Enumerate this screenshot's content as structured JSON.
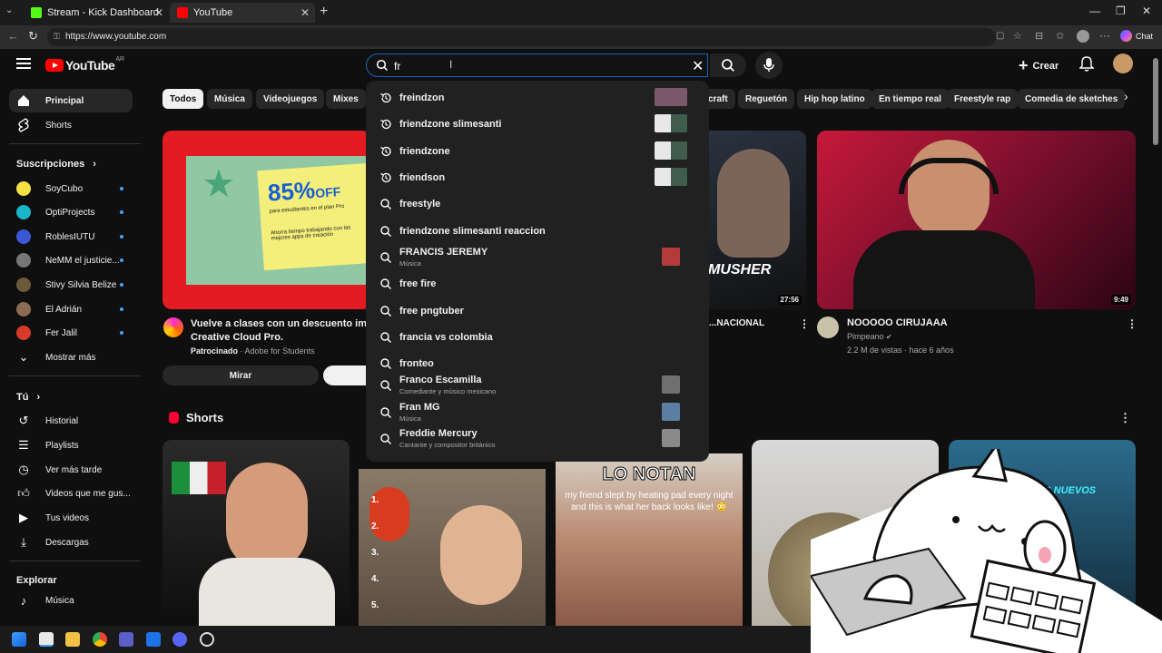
{
  "browser": {
    "tabs": [
      {
        "title": "Stream - Kick Dashboard",
        "favicon_color": "#53fc18"
      },
      {
        "title": "YouTube",
        "favicon_color": "#ff0000"
      }
    ],
    "url": "https://www.youtube.com",
    "chat_label": "Chat"
  },
  "header": {
    "logo_text": "YouTube",
    "country": "AR",
    "search_value": "fr",
    "create_label": "Crear"
  },
  "sidebar": {
    "main": [
      {
        "label": "Principal",
        "icon": "home-icon"
      },
      {
        "label": "Shorts",
        "icon": "shorts-icon"
      }
    ],
    "subscriptions_title": "Suscripciones",
    "subscriptions": [
      {
        "label": "SoyCubo",
        "color": "#f5e142"
      },
      {
        "label": "OptiProjects",
        "color": "#19b5c9"
      },
      {
        "label": "RoblesIUTU",
        "color": "#3b57d6"
      },
      {
        "label": "NeMM el justicie...",
        "color": "#777777"
      },
      {
        "label": "Stivy Silvia Belize",
        "color": "#6b5a3a"
      },
      {
        "label": "El Adrián",
        "color": "#8c6b55"
      },
      {
        "label": "Fer Jalil",
        "color": "#d63a2a"
      }
    ],
    "show_more": "Mostrar más",
    "you_title": "Tú",
    "you": [
      {
        "label": "Historial",
        "icon": "history-icon"
      },
      {
        "label": "Playlists",
        "icon": "playlists-icon"
      },
      {
        "label": "Ver más tarde",
        "icon": "watch-later-icon"
      },
      {
        "label": "Videos que me gus...",
        "icon": "like-icon"
      },
      {
        "label": "Tus videos",
        "icon": "your-videos-icon"
      },
      {
        "label": "Descargas",
        "icon": "download-icon"
      }
    ],
    "explore_title": "Explorar",
    "explore": [
      {
        "label": "Música",
        "icon": "music-icon"
      }
    ]
  },
  "chips": [
    "Todos",
    "Música",
    "Videojuegos",
    "Mixes",
    "craft",
    "Reguetón",
    "Hip hop latino",
    "En tiempo real",
    "Freestyle rap",
    "Comedia de sketches"
  ],
  "ad": {
    "title_line1": "Vuelve a clases con un descuento imper",
    "title_line2": "Creative Cloud Pro.",
    "sponsored": "Patrocinado",
    "advertiser": "Adobe for Students",
    "cta": "Mirar",
    "discount": "85%",
    "discount_suffix": "OFF",
    "sub_text": "para estudiantes en el plan Pro",
    "body_text": "Ahorra tiempo trabajando con las mejores apps de creación"
  },
  "videos": [
    {
      "title": "...NACIONAL",
      "duration": "27:56",
      "thumb_text": "MUSHER"
    },
    {
      "title": "NOOOOO CIRUJAAA",
      "channel": "Pimpeano",
      "meta": "2.2 M de vistas · hace 6 años",
      "duration": "9:49"
    }
  ],
  "shorts": {
    "title": "Shorts",
    "items": [
      {
        "overlay": ""
      },
      {
        "overlay": ""
      },
      {
        "overlay": "LO NOTAN",
        "caption": "my friend slept by heating pad every night and this is what her back looks like! 😳"
      },
      {
        "overlay": ""
      },
      {
        "overlay": "LOS NUEVOS"
      }
    ]
  },
  "suggestions": [
    {
      "text": "freindzon",
      "type": "history",
      "preview": true
    },
    {
      "text": "friendzone slimesanti",
      "type": "history",
      "preview": true
    },
    {
      "text": "friendzone",
      "type": "history",
      "preview": true
    },
    {
      "text": "friendson",
      "type": "history",
      "preview": true
    },
    {
      "text": "freestyle",
      "type": "search"
    },
    {
      "text": "friendzone slimesanti reaccion",
      "type": "search"
    },
    {
      "text": "FRANCIS JEREMY",
      "sub": "Música",
      "type": "search",
      "channel": true
    },
    {
      "text": "free fire",
      "type": "search"
    },
    {
      "text": "free pngtuber",
      "type": "search"
    },
    {
      "text": "francia vs colombia",
      "type": "search"
    },
    {
      "text": "fronteo",
      "type": "search"
    },
    {
      "text": "Franco Escamilla",
      "sub": "Comediante y músico mexicano",
      "type": "search",
      "channel": true
    },
    {
      "text": "Fran MG",
      "sub": "Música",
      "type": "search",
      "channel": true
    },
    {
      "text": "Freddie Mercury",
      "sub": "Cantante y compositor británico",
      "type": "search",
      "channel": true
    }
  ],
  "colors": {
    "bg": "#0f0f0f",
    "accent_blue": "#1c62b9",
    "yt_red": "#ff0000"
  }
}
